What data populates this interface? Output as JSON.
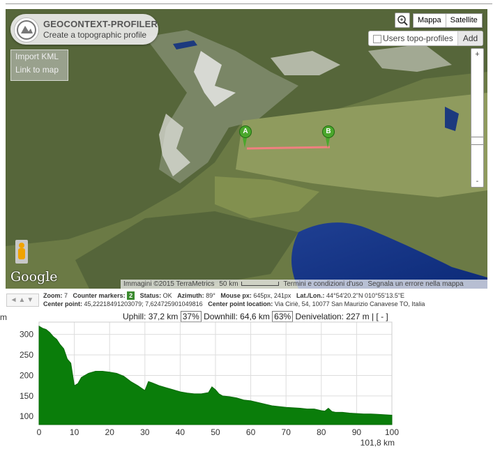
{
  "brand": {
    "title": "GEOCONTEXT-PROFILER",
    "subtitle": "Create a topographic profile"
  },
  "kml": {
    "import_label": "Import KML",
    "link_label": "Link to map"
  },
  "maptype": {
    "map_label": "Mappa",
    "satellite_label": "Satellite"
  },
  "users": {
    "label": "Users topo-profiles",
    "add_label": "Add"
  },
  "zoom": {
    "plus": "+",
    "minus": "-"
  },
  "google_logo": "Google",
  "attribution": {
    "imagery": "Immagini ©2015 TerraMetrics",
    "scale": "50 km",
    "terms": "Termini e condizioni d'uso",
    "report": "Segnala un errore nella mappa"
  },
  "markers": [
    {
      "label": "A"
    },
    {
      "label": "B"
    }
  ],
  "nav_arrows": "◄▲▼",
  "status": {
    "zoom_label": "Zoom:",
    "zoom_value": "7",
    "counter_label": "Counter markers:",
    "counter_value": "2",
    "status_label": "Status:",
    "status_value": "OK",
    "azimuth_label": "Azimuth:",
    "azimuth_value": "89°",
    "mouse_label": "Mouse px:",
    "mouse_value": "645px, 241px",
    "latlon_label": "Lat./Lon.:",
    "latlon_value": "44°54'20.2\"N 010°55'13.5\"E",
    "center_label": "Center point:",
    "center_value": "45,22218491203079; 7,624725901049816",
    "location_label": "Center point location:",
    "location_value": "Via Ciriè, 54, 10077 San Maurizio Canavese TO, Italia"
  },
  "summary": {
    "uphill_label": "Uphill:",
    "uphill_value": "37,2 km",
    "uphill_pct": "37%",
    "downhill_label": "Downhill:",
    "downhill_value": "64,6 km",
    "downhill_pct": "63%",
    "deniv_label": "Denivelation:",
    "deniv_value": "227 m",
    "controls": "| [ - ]"
  },
  "colors": {
    "fill": "#0a7d0a",
    "grid": "#dddddd",
    "route": "#f08080",
    "marker": "#4aa72c"
  },
  "chart_data": {
    "type": "area",
    "y_unit_label": "m",
    "x_unit_label": "101,8 km",
    "xlim": [
      0,
      100
    ],
    "ylim": [
      80,
      330
    ],
    "x_ticks": [
      0,
      10,
      20,
      30,
      40,
      50,
      60,
      70,
      80,
      90,
      100
    ],
    "y_ticks": [
      100,
      150,
      200,
      250,
      300
    ],
    "grid": true,
    "x": [
      0,
      1,
      2,
      3,
      4,
      5,
      6,
      7,
      8,
      9,
      10,
      11,
      12,
      14,
      16,
      18,
      20,
      22,
      24,
      26,
      28,
      30,
      31,
      32,
      34,
      36,
      38,
      40,
      42,
      44,
      46,
      48,
      49,
      50,
      51,
      52,
      54,
      56,
      58,
      60,
      62,
      64,
      66,
      68,
      70,
      72,
      74,
      76,
      78,
      80,
      81,
      82,
      83,
      84,
      86,
      88,
      90,
      92,
      94,
      96,
      98,
      100,
      101.8
    ],
    "y": [
      320,
      315,
      312,
      305,
      295,
      288,
      275,
      265,
      240,
      230,
      175,
      180,
      195,
      205,
      210,
      210,
      208,
      205,
      198,
      185,
      175,
      163,
      185,
      182,
      175,
      170,
      165,
      160,
      157,
      155,
      155,
      158,
      172,
      165,
      155,
      150,
      148,
      145,
      140,
      138,
      134,
      130,
      126,
      124,
      122,
      121,
      120,
      118,
      118,
      114,
      113,
      120,
      112,
      110,
      110,
      108,
      107,
      106,
      106,
      105,
      104,
      103,
      102
    ]
  }
}
